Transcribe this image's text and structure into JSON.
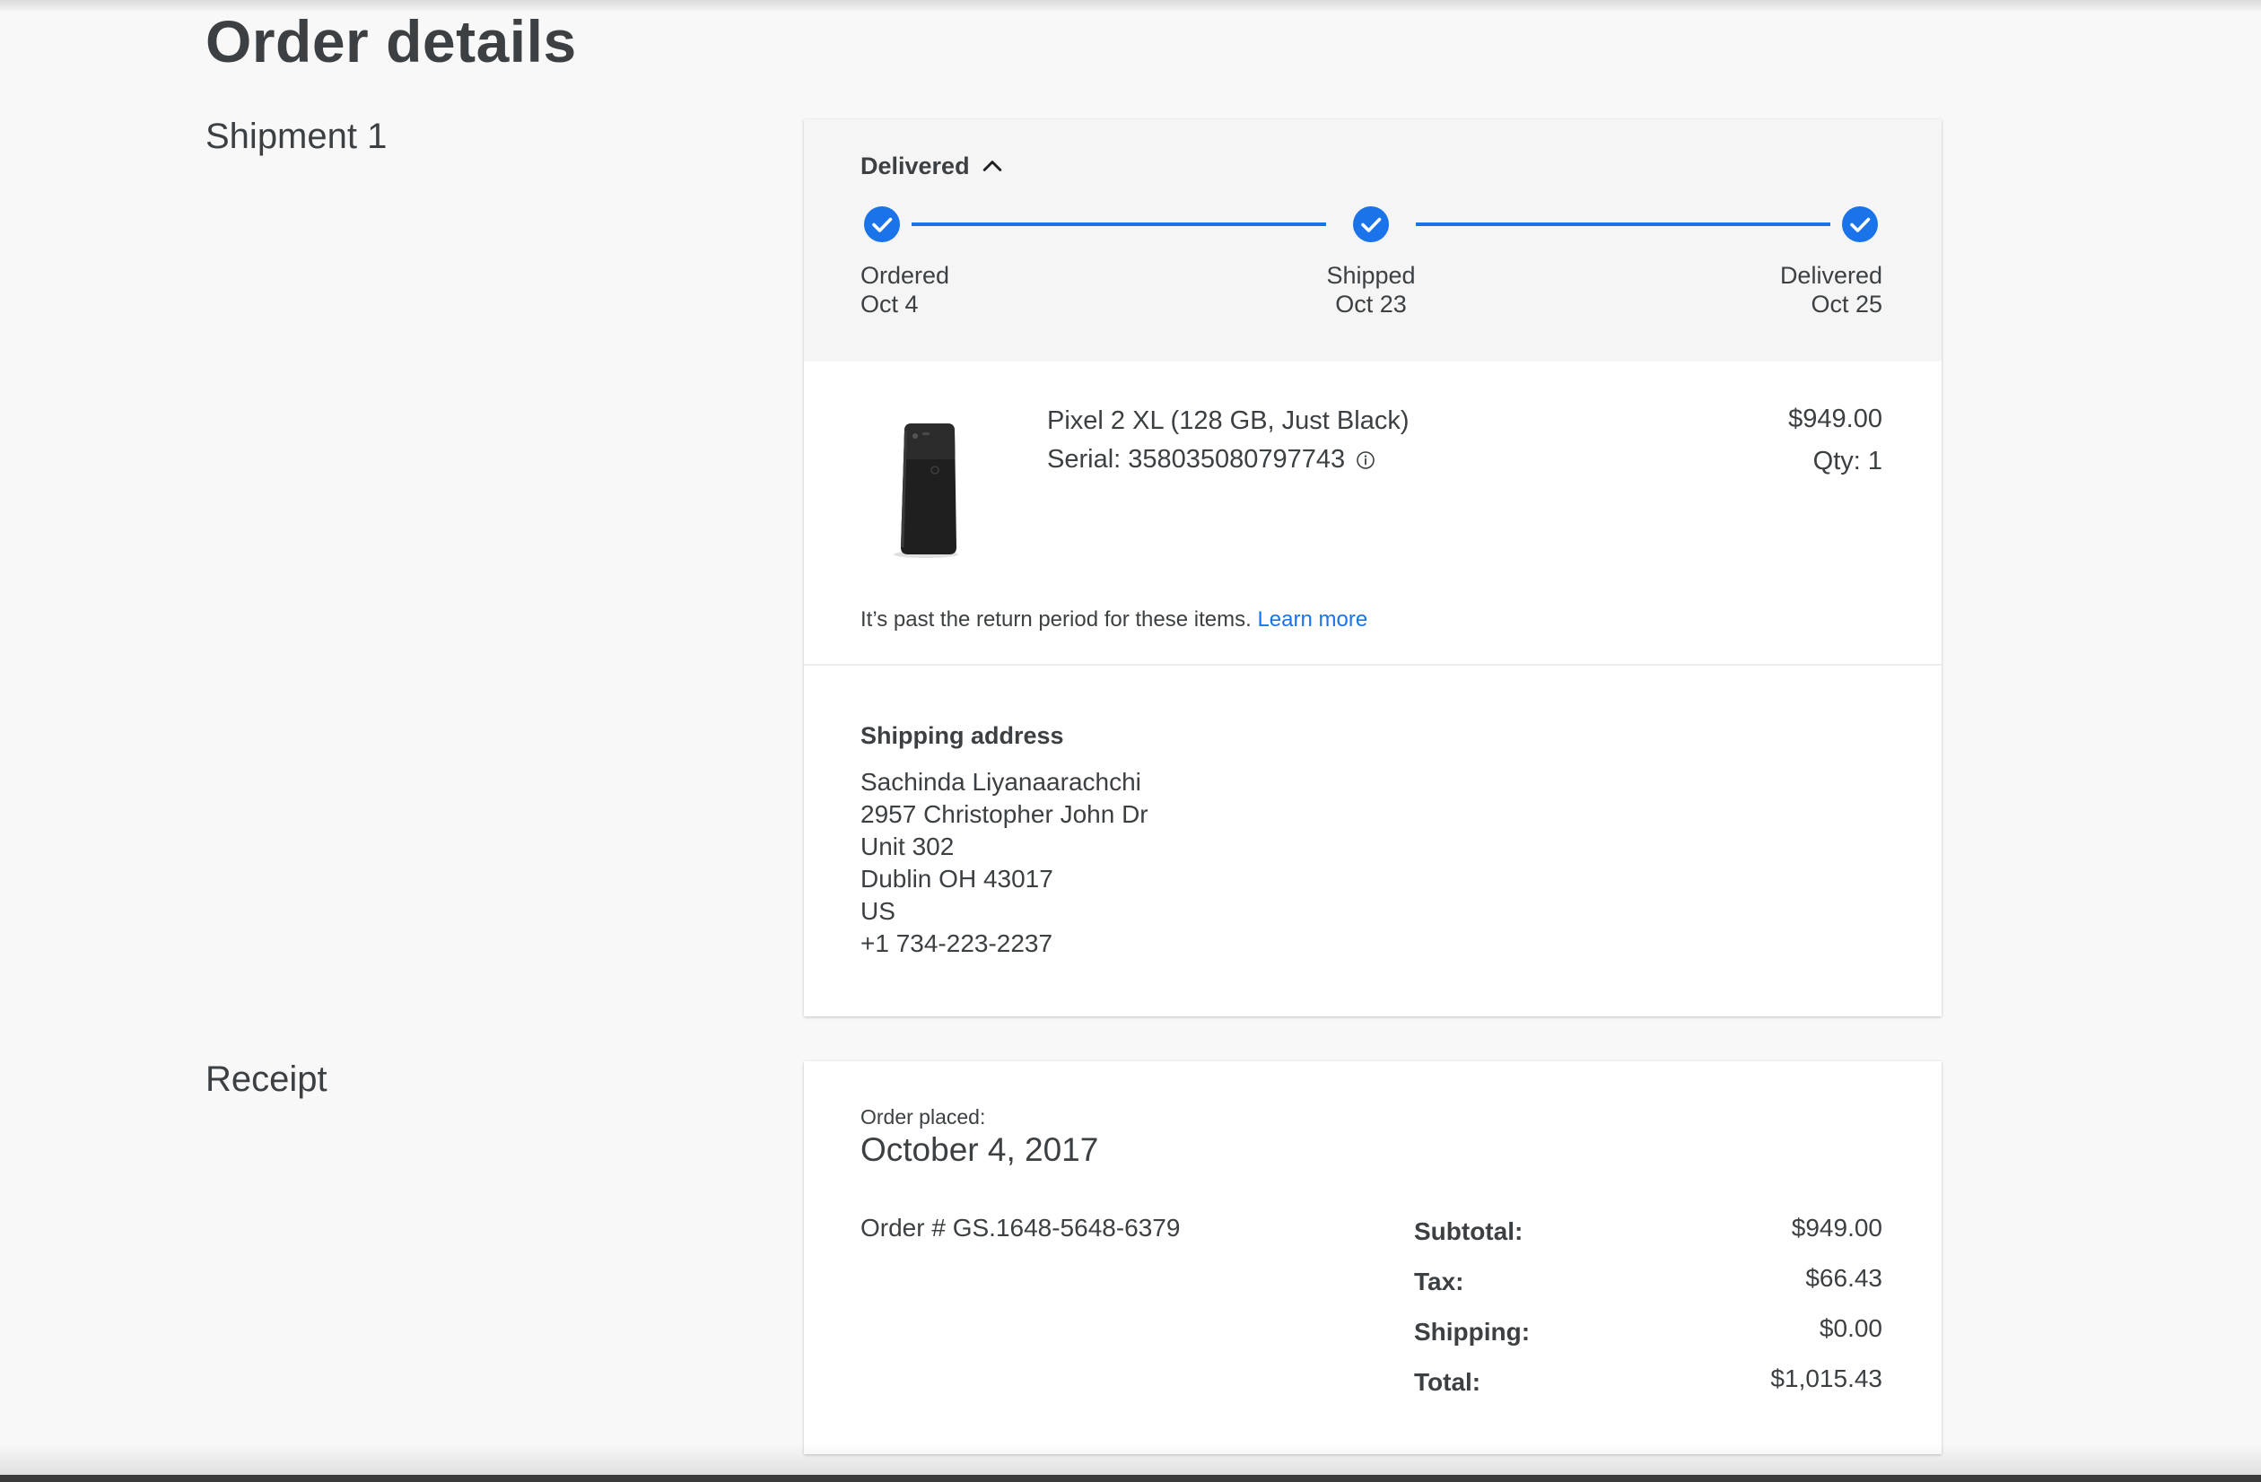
{
  "page": {
    "title": "Order details"
  },
  "shipment": {
    "section_title": "Shipment 1",
    "status": "Delivered",
    "steps": [
      {
        "label": "Ordered",
        "date": "Oct 4"
      },
      {
        "label": "Shipped",
        "date": "Oct 23"
      },
      {
        "label": "Delivered",
        "date": "Oct 25"
      }
    ],
    "item": {
      "name": "Pixel 2 XL (128 GB, Just Black)",
      "serial": "Serial: 358035080797743",
      "price": "$949.00",
      "qty": "Qty: 1"
    },
    "return_note": "It’s past the return period for these items.",
    "learn_more": "Learn more",
    "address": {
      "heading": "Shipping address",
      "lines": [
        "Sachinda Liyanaarachchi",
        "2957 Christopher John Dr",
        "Unit 302",
        "Dublin OH 43017",
        "US",
        "+1 734-223-2237"
      ]
    }
  },
  "receipt": {
    "section_title": "Receipt",
    "order_placed_label": "Order placed:",
    "order_placed_date": "October 4, 2017",
    "order_number": "Order # GS.1648-5648-6379",
    "totals": [
      {
        "label": "Subtotal:",
        "value": "$949.00"
      },
      {
        "label": "Tax:",
        "value": "$66.43"
      },
      {
        "label": "Shipping:",
        "value": "$0.00"
      },
      {
        "label": "Total:",
        "value": "$1,015.43"
      }
    ]
  },
  "colors": {
    "accent": "#1a73e8",
    "text": "#3c4043",
    "page_background": "#f8f8f8"
  },
  "icons": {
    "status_toggle": "chevron-up-icon",
    "step": "check-circle-icon",
    "serial_info": "info-icon"
  }
}
